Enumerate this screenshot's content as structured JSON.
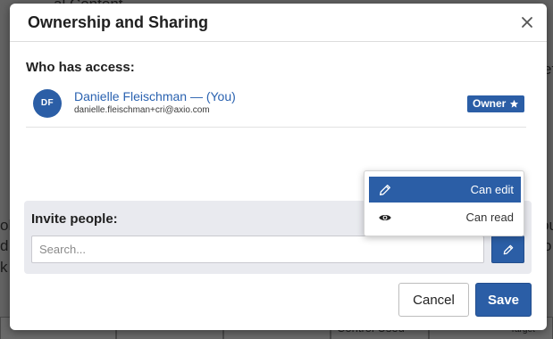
{
  "background": {
    "fragments": [
      "al Content",
      "ef",
      "ol",
      "d c",
      "ou",
      "",
      "o",
      "k",
      "Control Used",
      "Target"
    ]
  },
  "dialog": {
    "title": "Ownership and Sharing",
    "close_icon": "close-icon"
  },
  "access": {
    "heading": "Who has access:",
    "users": [
      {
        "initials": "DF",
        "name": "Danielle Fleischman — (You)",
        "email": "danielle.fleischman+cri@axio.com",
        "role": "Owner",
        "role_icon": "star-icon"
      }
    ]
  },
  "permission_menu": {
    "options": [
      {
        "label": "Can edit",
        "icon": "pencil-icon",
        "selected": true
      },
      {
        "label": "Can read",
        "icon": "eye-icon",
        "selected": false
      }
    ]
  },
  "invite": {
    "heading": "Invite people:",
    "search_placeholder": "Search...",
    "permission_button_icon": "pencil-icon"
  },
  "footer": {
    "cancel_label": "Cancel",
    "save_label": "Save"
  },
  "colors": {
    "accent": "#2b5ea6",
    "overlay": "#636363"
  }
}
